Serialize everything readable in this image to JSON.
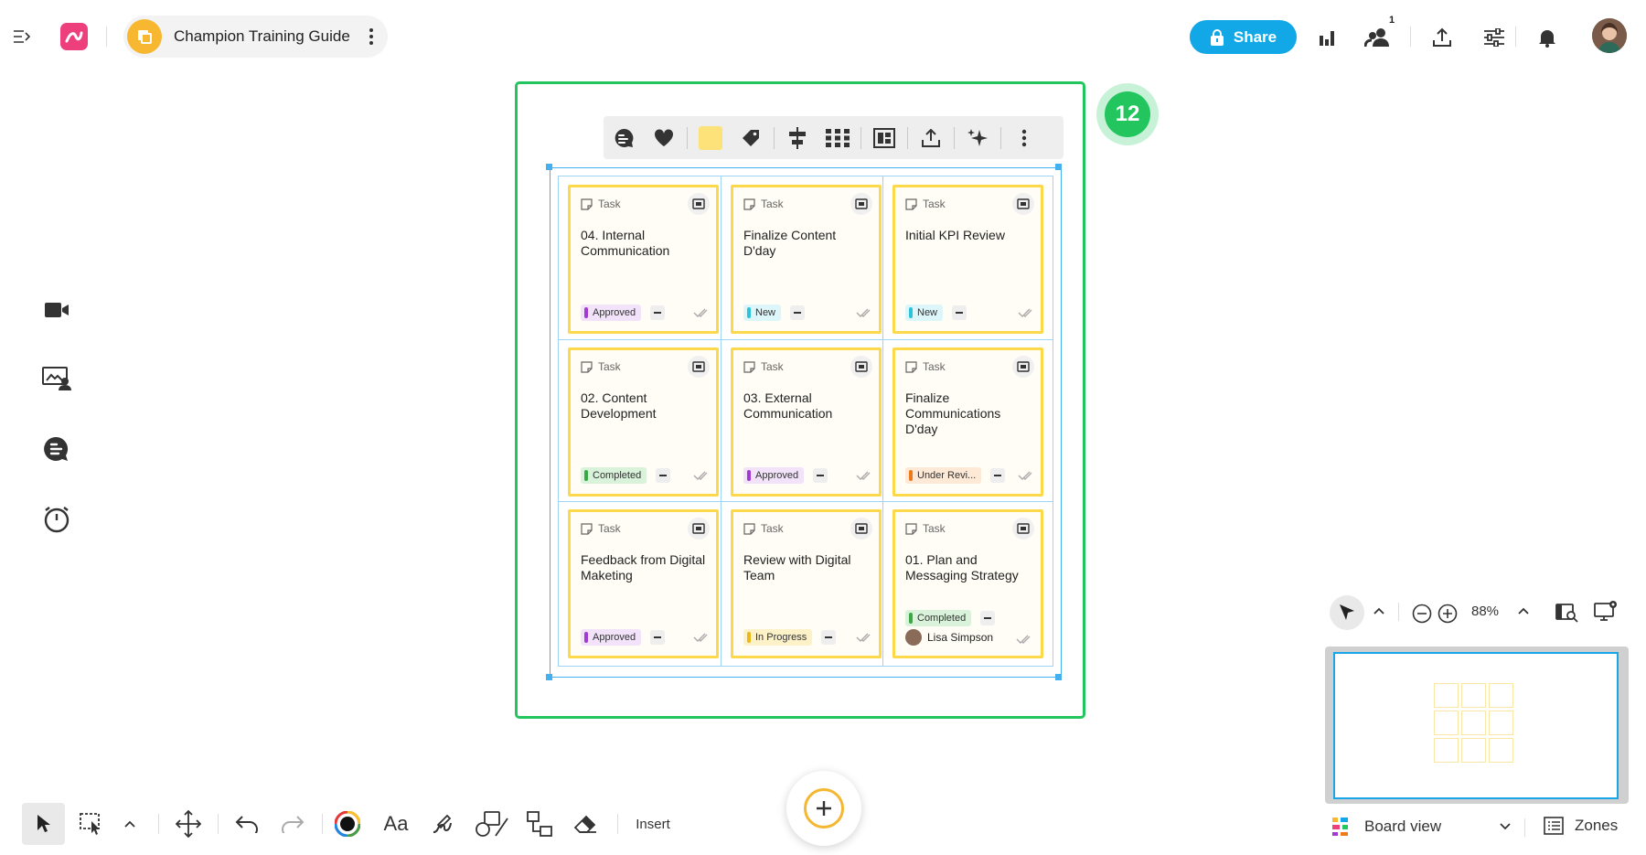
{
  "header": {
    "board_title": "Champion Training Guide",
    "share_label": "Share",
    "collaborator_count": "1",
    "brand_color": "#ee3f7d",
    "accent_color": "#12a8e8"
  },
  "left_tools": [
    {
      "icon": "video-icon"
    },
    {
      "icon": "presentation-icon"
    },
    {
      "icon": "comments-icon"
    },
    {
      "icon": "timer-icon"
    }
  ],
  "frame": {
    "badge": "12",
    "color": "#22c55e"
  },
  "cards": [
    {
      "type": "Task",
      "title": "04. Internal Communication",
      "status": "Approved",
      "status_color": "#a23bd1",
      "status_bg": "#f2e3fb"
    },
    {
      "type": "Task",
      "title": "Finalize Content D'day",
      "status": "New",
      "status_color": "#2fc3d8",
      "status_bg": "#ddf6fa"
    },
    {
      "type": "Task",
      "title": "Initial KPI Review",
      "status": "New",
      "status_color": "#2fc3d8",
      "status_bg": "#ddf6fa"
    },
    {
      "type": "Task",
      "title": "02. Content Development",
      "status": "Completed",
      "status_color": "#3aa845",
      "status_bg": "#d9f3da"
    },
    {
      "type": "Task",
      "title": "03. External Communication",
      "status": "Approved",
      "status_color": "#a23bd1",
      "status_bg": "#f2e3fb"
    },
    {
      "type": "Task",
      "title": "Finalize Communications D'day",
      "status": "Under Revi...",
      "status_color": "#ee7a1a",
      "status_bg": "#fde9d6"
    },
    {
      "type": "Task",
      "title": "Feedback from Digital Maketing",
      "status": "Approved",
      "status_color": "#a23bd1",
      "status_bg": "#f2e3fb"
    },
    {
      "type": "Task",
      "title": "Review with Digital Team",
      "status": "In Progress",
      "status_color": "#e8b81c",
      "status_bg": "#fcf1c7"
    },
    {
      "type": "Task",
      "title": "01. Plan and Messaging Strategy",
      "status": "Completed",
      "status_color": "#3aa845",
      "status_bg": "#d9f3da",
      "assignee": "Lisa Simpson"
    }
  ],
  "toolbar": {
    "insert_label": "Insert"
  },
  "zoom": {
    "level": "88%"
  },
  "footer": {
    "view_label": "Board view",
    "zones_label": "Zones"
  }
}
